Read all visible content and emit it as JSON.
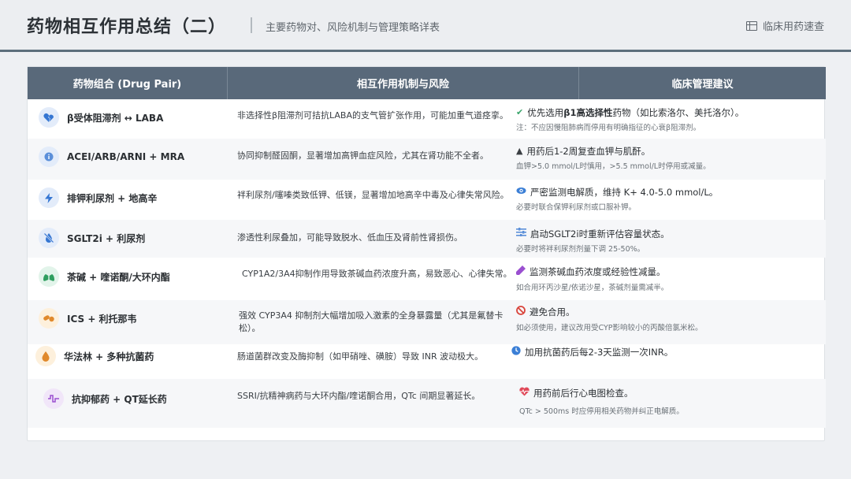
{
  "header": {
    "title": "药物相互作用总结（二）",
    "subtitle": "主要药物对、风险机制与管理策略详表",
    "quickref": "临床用药速查"
  },
  "table": {
    "columns": [
      "药物组合 (Drug Pair)",
      "相互作用机制与风险",
      "临床管理建议"
    ],
    "rows": [
      {
        "pair": "β受体阻滞剂 ↔ LABA",
        "icon": "broken-heart-icon",
        "mechanism": "非选择性β阻滞剂可拮抗LABA的支气管扩张作用，可能加重气道痉挛。",
        "advice_icon": "check-icon",
        "advice_pre": "优先选用",
        "advice_bold": "β1高选择性",
        "advice_post": "药物（如比索洛尔、美托洛尔）。",
        "note": "注：不应因慢阻肺病而停用有明确指征的心衰β阻滞剂。"
      },
      {
        "pair": "ACEI/ARB/ARNI + MRA",
        "icon": "info-icon",
        "mechanism": "协同抑制醛固酮，显著增加高钾血症风险，尤其在肾功能不全者。",
        "advice_icon": "warning-icon",
        "advice_pre": "用药后1-2周复查血钾与肌酐。",
        "advice_bold": "",
        "advice_post": "",
        "note": "血钾>5.0 mmol/L时慎用，>5.5 mmol/L时停用或减量。"
      },
      {
        "pair": "排钾利尿剂 + 地高辛",
        "icon": "lightning-icon",
        "mechanism": "袢利尿剂/噻嗪类致低钾、低镁，显著增加地高辛中毒及心律失常风险。",
        "advice_icon": "eye-icon",
        "advice_pre": "严密监测电解质，维持 K+ 4.0-5.0 mmol/L。",
        "advice_bold": "",
        "advice_post": "",
        "note": "必要时联合保钾利尿剂或口服补钾。"
      },
      {
        "pair": "SGLT2i + 利尿剂",
        "icon": "no-droplet-icon",
        "mechanism": "渗透性利尿叠加，可能导致脱水、低血压及肾前性肾损伤。",
        "advice_icon": "sliders-icon",
        "advice_pre": "启动SGLT2i时重新评估容量状态。",
        "advice_bold": "",
        "advice_post": "",
        "note": "必要时将袢利尿剂剂量下调 25-50%。"
      },
      {
        "pair": "茶碱 + 喹诺酮/大环内酯",
        "icon": "lungs-icon",
        "mechanism": "CYP1A2/3A4抑制作用导致茶碱血药浓度升高，易致恶心、心律失常。",
        "advice_icon": "vial-icon",
        "advice_pre": "监测茶碱血药浓度或经验性减量。",
        "advice_bold": "",
        "advice_post": "",
        "note": "如合用环丙沙星/依诺沙星，茶碱剂量需减半。"
      },
      {
        "pair": "ICS + 利托那韦",
        "icon": "pills-icon",
        "mechanism": "强效 CYP3A4 抑制剂大幅增加吸入激素的全身暴露量（尤其是氟替卡松）。",
        "advice_icon": "ban-icon",
        "advice_pre": "避免合用。",
        "advice_bold": "",
        "advice_post": "",
        "note": "如必须使用，建议改用受CYP影响较小的丙酸倍氯米松。"
      },
      {
        "pair": "华法林 + 多种抗菌药",
        "icon": "drop-icon",
        "mechanism": "肠道菌群改变及酶抑制（如甲硝唑、磺胺）导致 INR 波动极大。",
        "advice_icon": "clock-icon",
        "advice_pre": "加用抗菌药后每2-3天监测一次INR。",
        "advice_bold": "",
        "advice_post": "",
        "note": ""
      },
      {
        "pair": "抗抑郁药 + QT延长药",
        "icon": "pulse-wave-icon",
        "mechanism": "SSRI/抗精神病药与大环内酯/喹诺酮合用，QTc 间期显著延长。",
        "advice_icon": "heart-pulse-icon",
        "advice_pre": "用药前后行心电图检查。",
        "advice_bold": "",
        "advice_post": "",
        "note": "QTc > 500ms 时应停用相关药物并纠正电解质。"
      }
    ]
  },
  "colors": {
    "header_bg": "#59697a",
    "accent_rule": "#5d6f7c",
    "check": "#3aa56b",
    "warning": "#3b3f44",
    "eye": "#3b7fd6",
    "sliders": "#5b8fd9",
    "vial": "#9a4fd0",
    "ban": "#d9453c",
    "clock": "#3b7fd6",
    "heart": "#e04a5a"
  }
}
